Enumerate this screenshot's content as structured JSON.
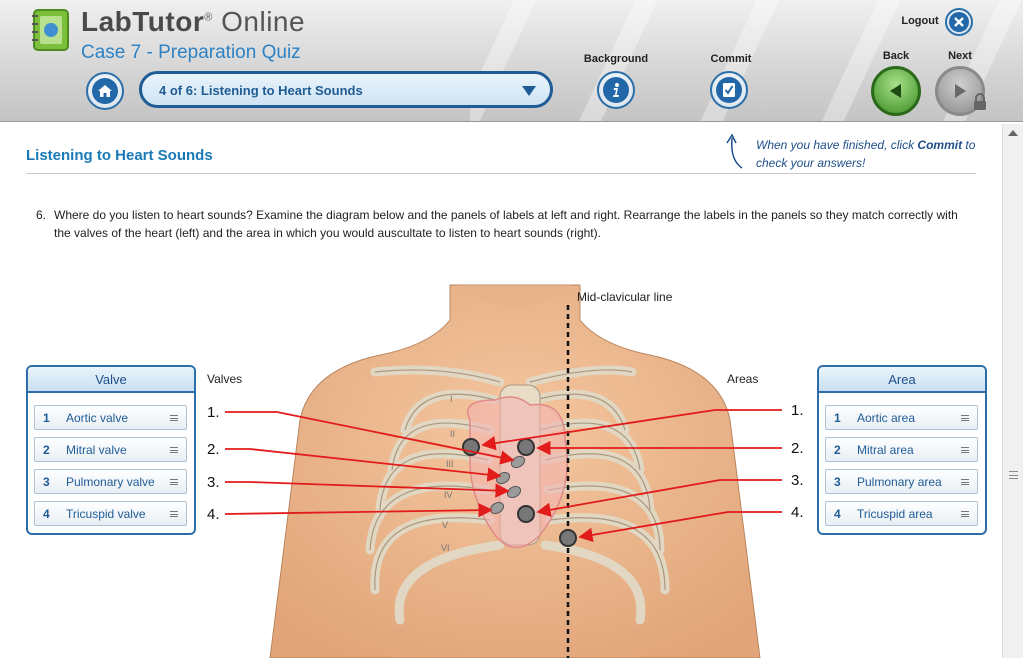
{
  "header": {
    "brand_name": "LabTutor",
    "brand_suffix": "Online",
    "case_title": "Case 7 - Preparation Quiz",
    "quiz_select_value": "4 of 6: Listening to Heart Sounds",
    "background_label": "Background",
    "commit_label": "Commit",
    "logout_label": "Logout",
    "back_label": "Back",
    "next_label": "Next"
  },
  "content": {
    "section_title": "Listening to Heart Sounds",
    "commit_hint_pre": "When you have finished, click ",
    "commit_hint_bold": "Commit",
    "commit_hint_post": " to check your answers!",
    "question_number": "6.",
    "question_text": "Where do you listen to heart sounds? Examine the diagram below and the panels of labels at left and right. Rearrange the labels in the panels so they match correctly with the valves of the heart (left) and the area in which you would auscultate to listen to heart sounds (right)."
  },
  "diagram": {
    "valves_heading": "Valves",
    "areas_heading": "Areas",
    "midclavicular_label": "Mid-clavicular line",
    "left_numbers": [
      "1.",
      "2.",
      "3.",
      "4."
    ],
    "right_numbers": [
      "1.",
      "2.",
      "3.",
      "4."
    ],
    "rib_numerals": [
      "I",
      "II",
      "III",
      "IV",
      "V",
      "VI"
    ]
  },
  "valve_panel": {
    "title": "Valve",
    "items": [
      {
        "n": "1",
        "label": "Aortic valve"
      },
      {
        "n": "2",
        "label": "Mitral valve"
      },
      {
        "n": "3",
        "label": "Pulmonary valve"
      },
      {
        "n": "4",
        "label": "Tricuspid valve"
      }
    ]
  },
  "area_panel": {
    "title": "Area",
    "items": [
      {
        "n": "1",
        "label": "Aortic area"
      },
      {
        "n": "2",
        "label": "Mitral area"
      },
      {
        "n": "3",
        "label": "Pulmonary area"
      },
      {
        "n": "4",
        "label": "Tricuspid area"
      }
    ]
  },
  "colors": {
    "accent_blue": "#1f5c95",
    "title_blue": "#1a7ab8",
    "arrow_red": "#e21b1b",
    "back_green": "#3a8d22"
  }
}
